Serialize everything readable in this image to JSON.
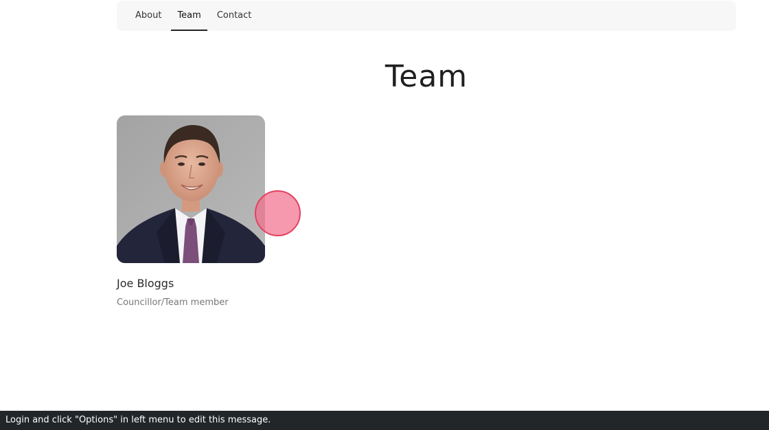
{
  "nav": {
    "items": [
      {
        "label": "About",
        "active": false
      },
      {
        "label": "Team",
        "active": true
      },
      {
        "label": "Contact",
        "active": false
      }
    ]
  },
  "page": {
    "title": "Team"
  },
  "members": [
    {
      "name": "Joe Bloggs",
      "role": "Councillor/Team member"
    }
  ],
  "footer": {
    "message": "Login and click \"Options\" in left menu to edit this message."
  },
  "colors": {
    "nav_background": "#f7f7f7",
    "footer_background": "#232629",
    "cursor_fill": "#f46e8c",
    "cursor_border": "#e2425e"
  }
}
